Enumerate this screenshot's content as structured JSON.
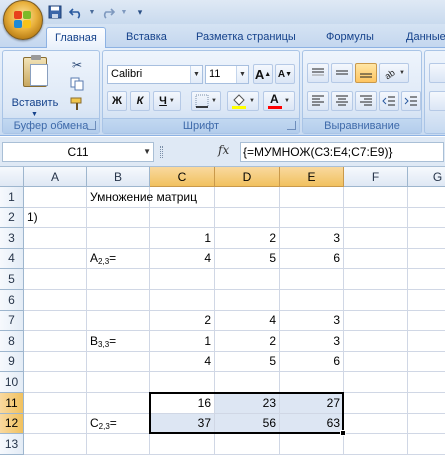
{
  "quick_access": {
    "icons": [
      "save-icon",
      "undo-icon",
      "redo-icon",
      "customize-icon"
    ]
  },
  "tabs": [
    {
      "label": "Главная",
      "active": true
    },
    {
      "label": "Вставка",
      "active": false
    },
    {
      "label": "Разметка страницы",
      "active": false
    },
    {
      "label": "Формулы",
      "active": false
    },
    {
      "label": "Данные",
      "active": false
    }
  ],
  "ribbon": {
    "clipboard": {
      "label": "Буфер обмена",
      "paste_label": "Вставить"
    },
    "font": {
      "label": "Шрифт",
      "font_name": "Calibri",
      "font_size": "11",
      "bold": "Ж",
      "italic": "К",
      "underline": "Ч",
      "grow": "A",
      "shrink": "A",
      "font_color_letter": "A",
      "fill_color": "#ffff00",
      "font_color": "#ff0000"
    },
    "alignment": {
      "label": "Выравнивание"
    }
  },
  "formula_bar": {
    "name_box": "C11",
    "fx": "fx",
    "formula": "{=МУМНОЖ(C3:E4;C7:E9)}"
  },
  "grid": {
    "columns": [
      "A",
      "B",
      "C",
      "D",
      "E",
      "F",
      "G"
    ],
    "selected_columns": [
      "C",
      "D",
      "E"
    ],
    "rows": [
      "1",
      "2",
      "3",
      "4",
      "5",
      "6",
      "7",
      "8",
      "9",
      "10",
      "11",
      "12",
      "13"
    ],
    "selected_rows": [
      "11",
      "12"
    ],
    "cells": {
      "B1": "Умножение матриц",
      "A2": "1)",
      "C3": "1",
      "D3": "2",
      "E3": "3",
      "B4_base": "A",
      "B4_sub": "2,3",
      "B4_eq": "=",
      "C4": "4",
      "D4": "5",
      "E4": "6",
      "C7": "2",
      "D7": "4",
      "E7": "3",
      "B8_base": "B",
      "B8_sub": "3,3",
      "B8_eq": "=",
      "C8": "1",
      "D8": "2",
      "E8": "3",
      "C9": "4",
      "D9": "5",
      "E9": "6",
      "C11": "16",
      "D11": "23",
      "E11": "27",
      "B12_base": "C",
      "B12_sub": "2,3",
      "B12_eq": "=",
      "C12": "37",
      "D12": "56",
      "E12": "63"
    }
  }
}
